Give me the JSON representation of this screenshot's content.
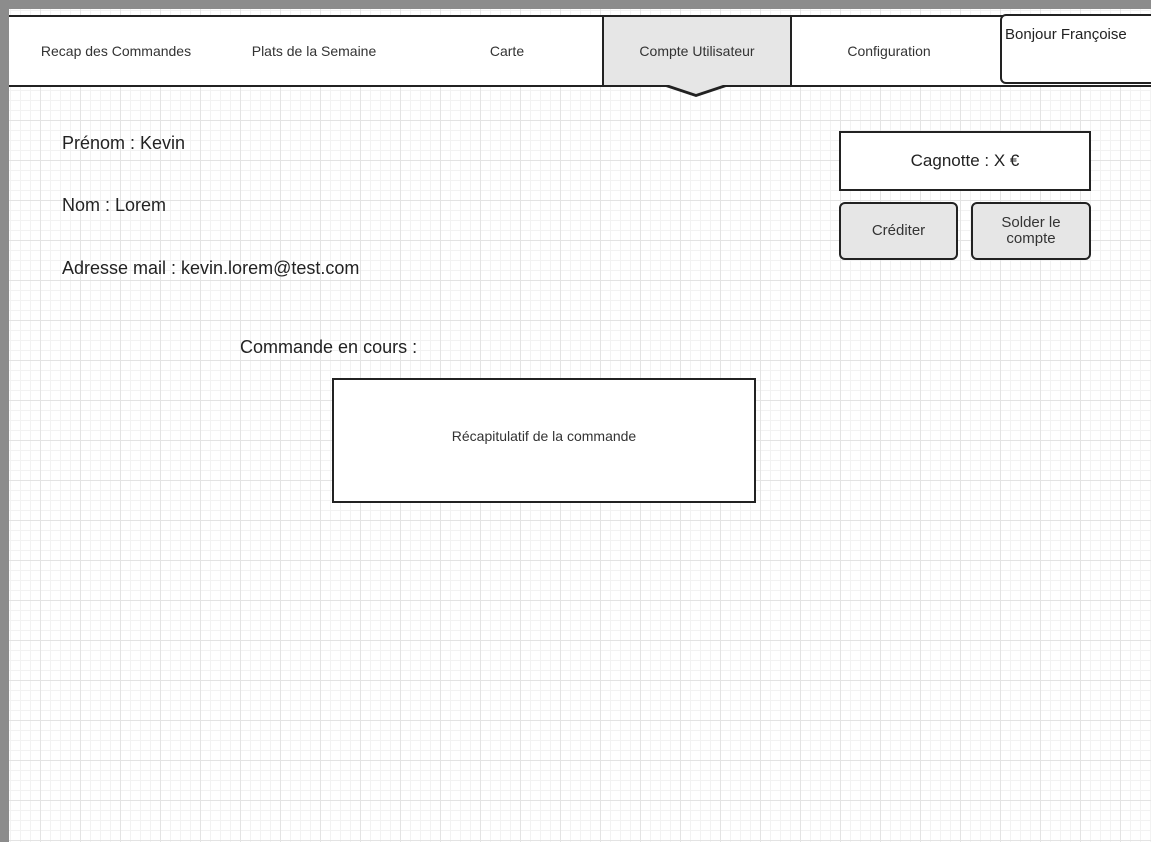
{
  "nav": {
    "items": [
      {
        "label": "Recap des Commandes"
      },
      {
        "label": "Plats de la Semaine"
      },
      {
        "label": "Carte"
      },
      {
        "label": "Compte Utilisateur",
        "active": true
      },
      {
        "label": "Configuration"
      }
    ],
    "greeting": "Bonjour Françoise"
  },
  "user": {
    "first_name": "Prénom : Kevin",
    "last_name": "Nom : Lorem",
    "email": "Adresse mail : kevin.lorem@test.com"
  },
  "wallet": {
    "balance_label": "Cagnotte : X €",
    "credit_button": "Créditer",
    "settle_button_line1": "Solder le",
    "settle_button_line2": "compte"
  },
  "order": {
    "section_title": "Commande en cours :",
    "summary_placeholder": "Récapitulatif de la commande"
  },
  "colors": {
    "active_tab": "#e6e6e6",
    "border": "#222222",
    "frame": "#8c8c8c"
  }
}
